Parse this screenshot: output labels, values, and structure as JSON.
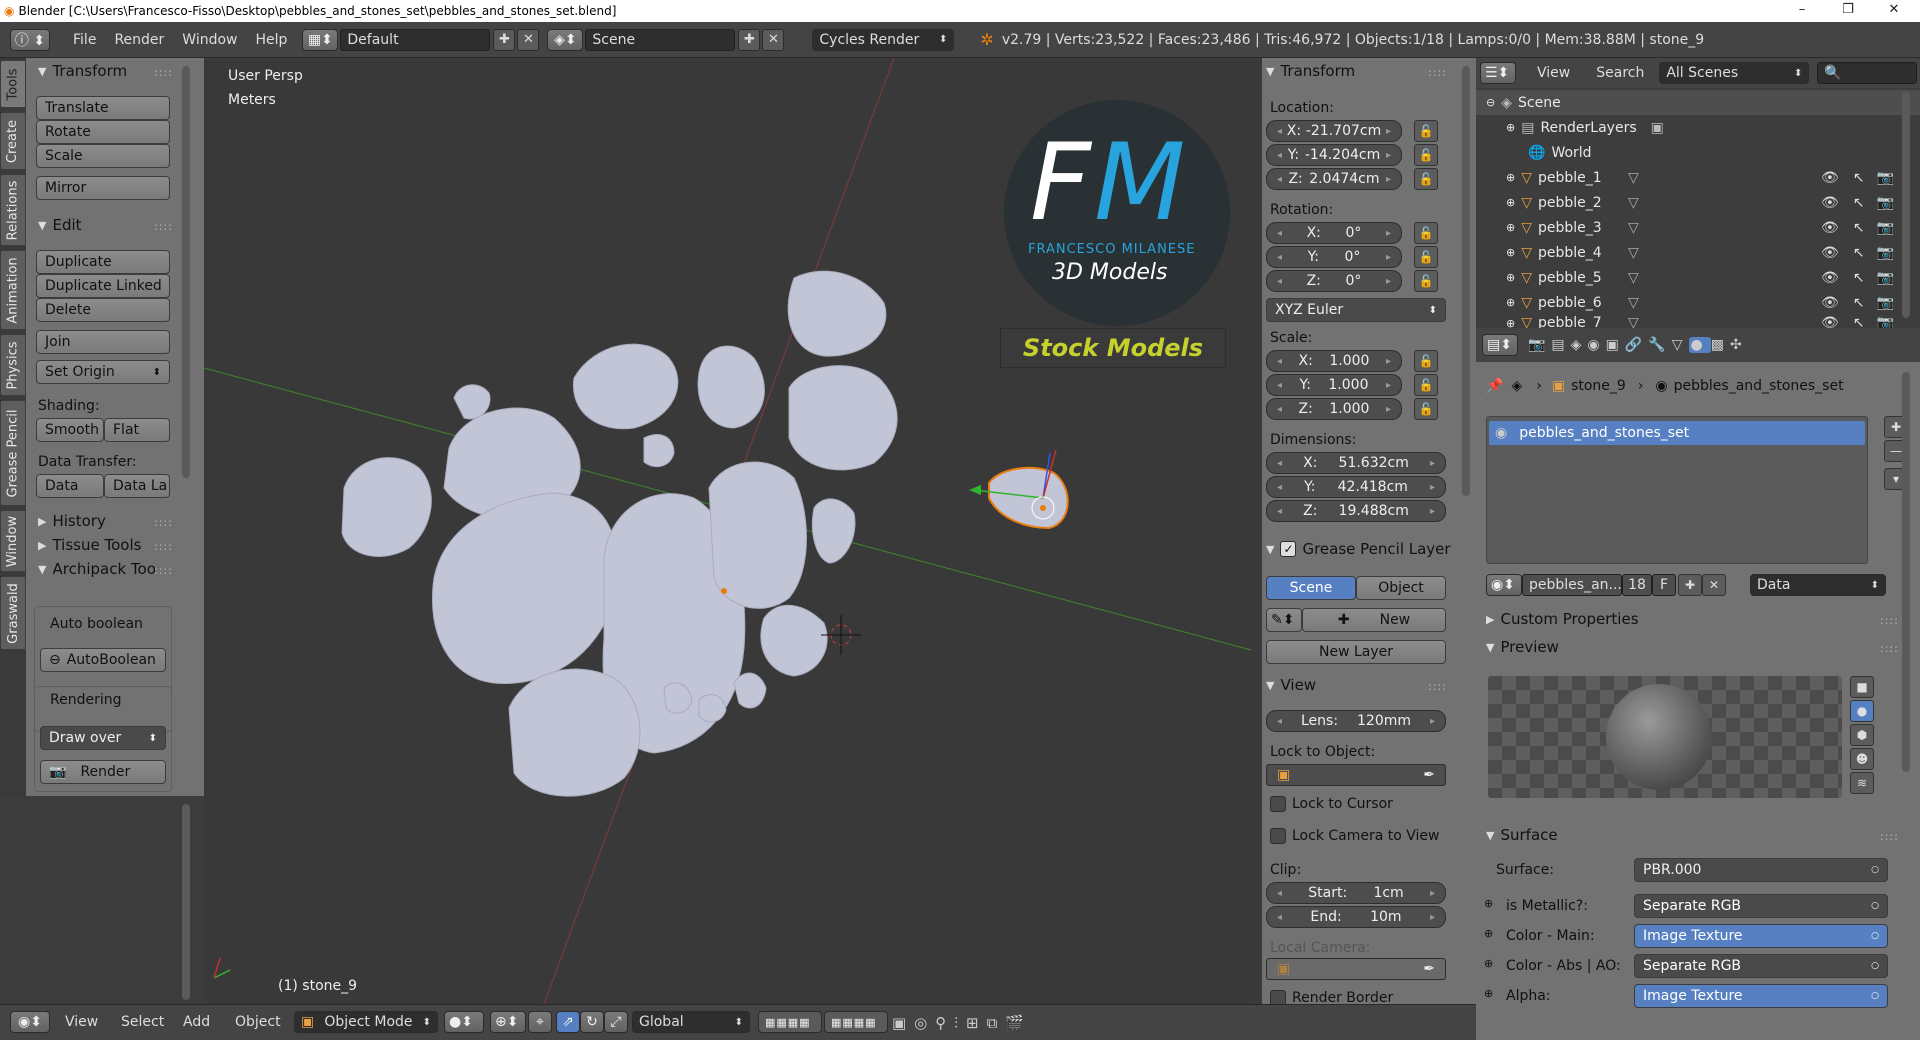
{
  "window": {
    "title": "Blender [C:\\Users\\Francesco-Fisso\\Desktop\\pebbles_and_stones_set\\pebbles_and_stones_set.blend]",
    "minimize": "–",
    "maximize": "❐",
    "close": "✕"
  },
  "header": {
    "menus": [
      "File",
      "Render",
      "Window",
      "Help"
    ],
    "layout": "Default",
    "scene": "Scene",
    "engine": "Cycles Render",
    "stats": "v2.79 | Verts:23,522 | Faces:23,486 | Tris:46,972 | Objects:1/18 | Lamps:0/0 | Mem:38.88M | stone_9"
  },
  "tabs": [
    "Tools",
    "Create",
    "Relations",
    "Animation",
    "Physics",
    "Grease Pencil",
    "Window",
    "Graswald"
  ],
  "tools": {
    "transform_title": "Transform",
    "translate": "Translate",
    "rotate": "Rotate",
    "scale": "Scale",
    "mirror": "Mirror",
    "edit_title": "Edit",
    "duplicate": "Duplicate",
    "duplicate_linked": "Duplicate Linked",
    "delete": "Delete",
    "join": "Join",
    "set_origin": "Set Origin",
    "shading_label": "Shading:",
    "smooth": "Smooth",
    "flat": "Flat",
    "data_transfer_label": "Data Transfer:",
    "data": "Data",
    "data_la": "Data La",
    "history": "History",
    "tissue": "Tissue Tools",
    "archipack": "Archipack Too",
    "auto_boolean_label": "Auto boolean",
    "auto_boolean_btn": "AutoBoolean",
    "rendering_label": "Rendering",
    "draw_over": "Draw over",
    "render_btn": "Render"
  },
  "viewport": {
    "persp": "User Persp",
    "units": "Meters",
    "object_label": "(1) stone_9",
    "logo": {
      "letters_f": "F",
      "letters_m": "M",
      "brand": "FRANCESCO MILANESE",
      "subtitle": "3D Models",
      "banner": "Stock Models"
    }
  },
  "transform": {
    "title": "Transform",
    "location_label": "Location:",
    "loc_x": "X:",
    "loc_x_val": "-21.707cm",
    "loc_y": "Y:",
    "loc_y_val": "-14.204cm",
    "loc_z": "Z:",
    "loc_z_val": "2.0474cm",
    "rotation_label": "Rotation:",
    "rot_x": "X:",
    "rot_x_val": "0°",
    "rot_y": "Y:",
    "rot_y_val": "0°",
    "rot_z": "Z:",
    "rot_z_val": "0°",
    "rot_mode": "XYZ Euler",
    "scale_label": "Scale:",
    "sc_x": "X:",
    "sc_x_val": "1.000",
    "sc_y": "Y:",
    "sc_y_val": "1.000",
    "sc_z": "Z:",
    "sc_z_val": "1.000",
    "dim_label": "Dimensions:",
    "dim_x": "X:",
    "dim_x_val": "51.632cm",
    "dim_y": "Y:",
    "dim_y_val": "42.418cm",
    "dim_z": "Z:",
    "dim_z_val": "19.488cm"
  },
  "grease": {
    "title": "Grease Pencil Layer",
    "scene": "Scene",
    "object": "Object",
    "new": "New",
    "new_layer": "New Layer"
  },
  "view": {
    "title": "View",
    "lens_label": "Lens:",
    "lens_val": "120mm",
    "lock_obj": "Lock to Object:",
    "lock_cursor": "Lock to Cursor",
    "lock_camera": "Lock Camera to View",
    "clip": "Clip:",
    "start_label": "Start:",
    "start_val": "1cm",
    "end_label": "End:",
    "end_val": "10m",
    "local_camera": "Local Camera:",
    "render_border": "Render Border"
  },
  "outliner": {
    "view": "View",
    "search": "Search",
    "filter": "All Scenes",
    "items": [
      "Scene",
      "RenderLayers",
      "World",
      "pebble_1",
      "pebble_2",
      "pebble_3",
      "pebble_4",
      "pebble_5",
      "pebble_6",
      "pebble_7"
    ]
  },
  "props": {
    "crumb_obj": "stone_9",
    "crumb_mat": "pebbles_and_stones_set",
    "slot": "pebbles_and_stones_set",
    "mat_name": "pebbles_an...",
    "users": "18",
    "fake": "F",
    "link": "Data",
    "custom": "Custom Properties",
    "preview": "Preview",
    "surface_title": "Surface",
    "surface_label": "Surface:",
    "surface_val": "PBR.000",
    "rows": [
      {
        "label": "is Metallic?:",
        "val": "Separate RGB"
      },
      {
        "label": "Color - Main:",
        "val": "Image Texture"
      },
      {
        "label": "Color - Abs | AO:",
        "val": "Separate RGB"
      },
      {
        "label": "Alpha:",
        "val": "Image Texture"
      }
    ]
  },
  "bottom": {
    "menus": [
      "View",
      "Select",
      "Add",
      "Object"
    ],
    "mode": "Object Mode",
    "orientation": "Global"
  },
  "colors": {
    "accent": "#5680c2",
    "panel": "#727272",
    "viewport": "#393939",
    "header": "#444444",
    "logo_blue": "#29a3dd",
    "banner_text": "#c7d12e"
  }
}
